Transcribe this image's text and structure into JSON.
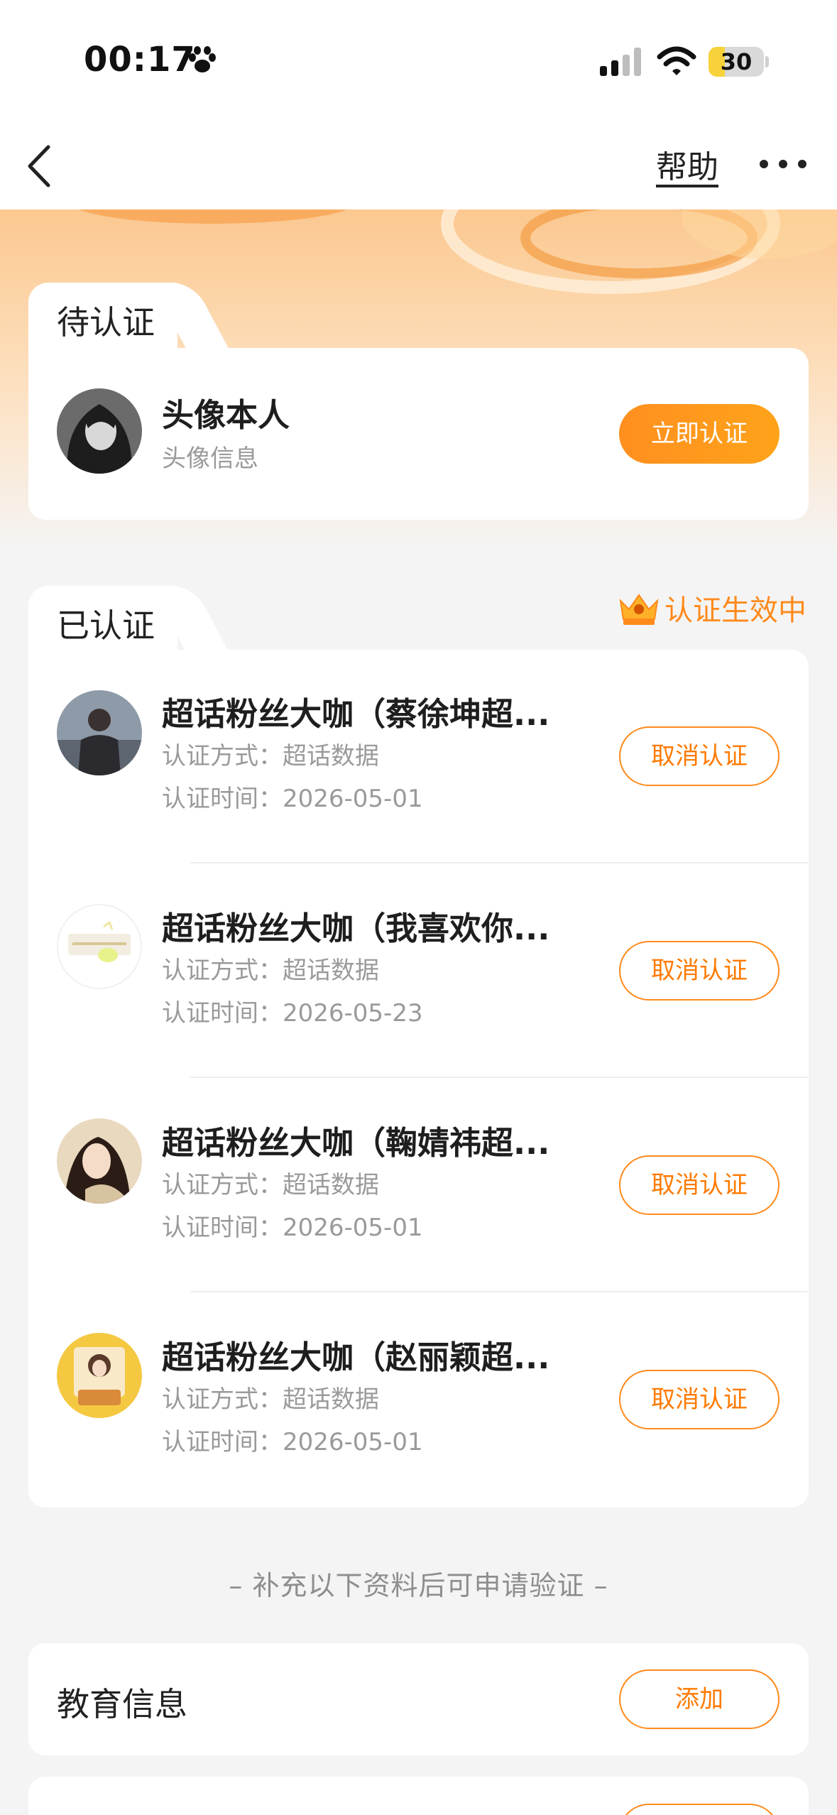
{
  "status_bar": {
    "time": "00:17",
    "battery": "30",
    "battery_level": 0.3,
    "icons": [
      "paw-icon",
      "signal-icon",
      "wifi-icon",
      "battery-icon"
    ]
  },
  "nav": {
    "help_label": "帮助",
    "icons": [
      "back-icon",
      "more-icon"
    ]
  },
  "pending": {
    "tab_label": "待认证",
    "item": {
      "title": "头像本人",
      "subtitle": "头像信息",
      "action": "立即认证"
    }
  },
  "verified": {
    "tab_label": "已认证",
    "status": "认证生效中",
    "items": [
      {
        "title": "超话粉丝大咖（蔡徐坤超...",
        "method": "认证方式：超话数据",
        "time": "认证时间：2026-05-01",
        "action": "取消认证"
      },
      {
        "title": "超话粉丝大咖（我喜欢你...",
        "method": "认证方式：超话数据",
        "time": "认证时间：2026-05-23",
        "action": "取消认证"
      },
      {
        "title": "超话粉丝大咖（鞠婧祎超...",
        "method": "认证方式：超话数据",
        "time": "认证时间：2026-05-01",
        "action": "取消认证"
      },
      {
        "title": "超话粉丝大咖（赵丽颖超...",
        "method": "认证方式：超话数据",
        "time": "认证时间：2026-05-01",
        "action": "取消认证"
      }
    ]
  },
  "footer_note": "– 补充以下资料后可申请验证 –",
  "education": {
    "label": "教育信息",
    "action": "添加"
  },
  "colors": {
    "accent": "#ff8a1c",
    "button_fill": "#ffa31a",
    "background": "#f4f4f4"
  }
}
